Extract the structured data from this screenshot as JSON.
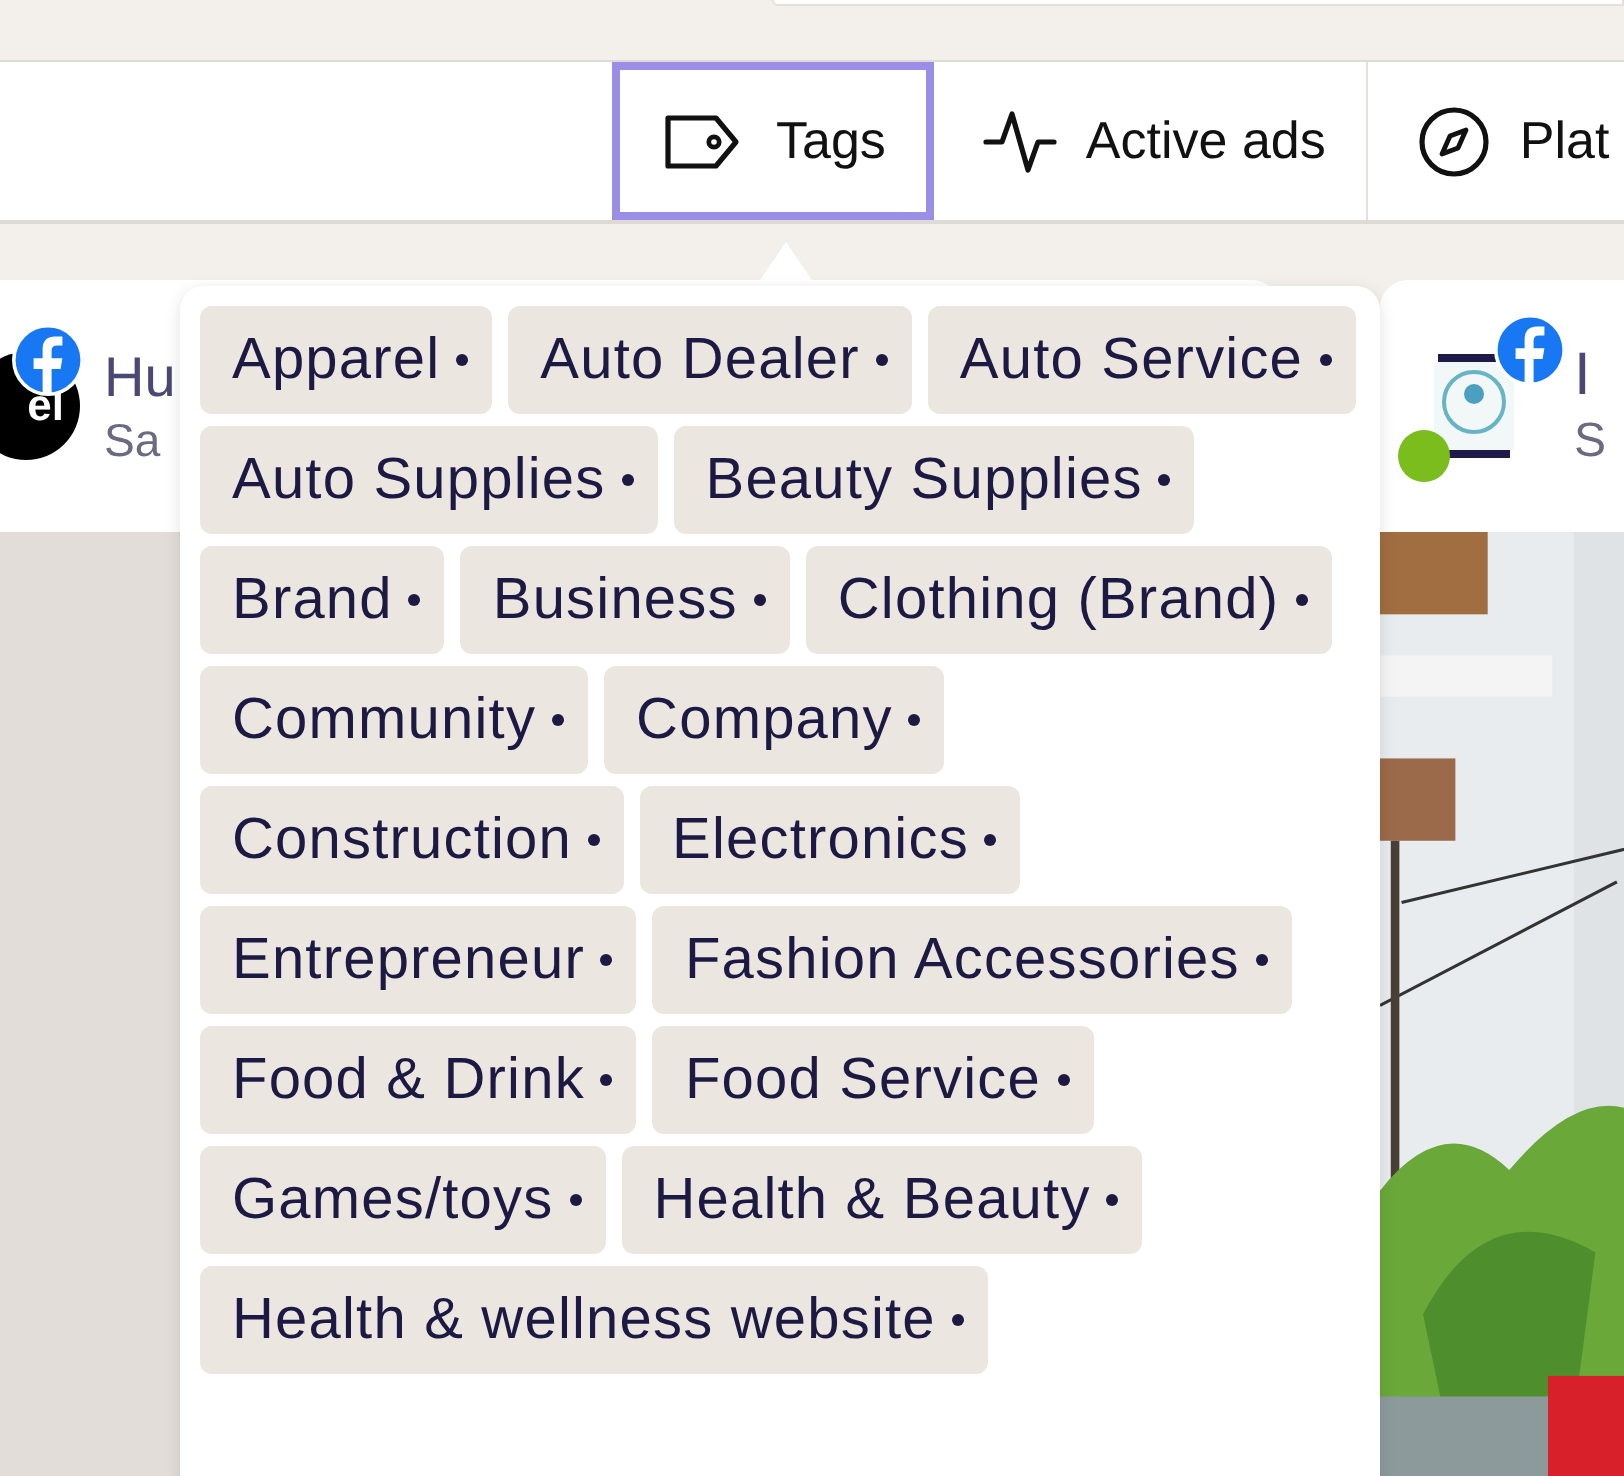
{
  "toolbar": {
    "tabs": [
      {
        "label": "Tags",
        "kind": "tag",
        "selected": true
      },
      {
        "label": "Active ads",
        "kind": "pulse",
        "selected": false
      },
      {
        "label": "Plat",
        "kind": "compass",
        "selected": false
      }
    ]
  },
  "cards": [
    {
      "avatar_text": "el",
      "name": "Hu",
      "subtitle": "Sa",
      "status_dot": false
    },
    {
      "name": "I",
      "subtitle": "S",
      "status_dot": true
    }
  ],
  "tags_popover": {
    "tags": [
      "Apparel",
      "Auto Dealer",
      "Auto Service",
      "Auto Supplies",
      "Beauty Supplies",
      "Brand",
      "Business",
      "Clothing (Brand)",
      "Community",
      "Company",
      "Construction",
      "Electronics",
      "Entrepreneur",
      "Fashion Accessories",
      "Food & Drink",
      "Food Service",
      "Games/toys",
      "Health & Beauty",
      "Health & wellness website"
    ]
  }
}
